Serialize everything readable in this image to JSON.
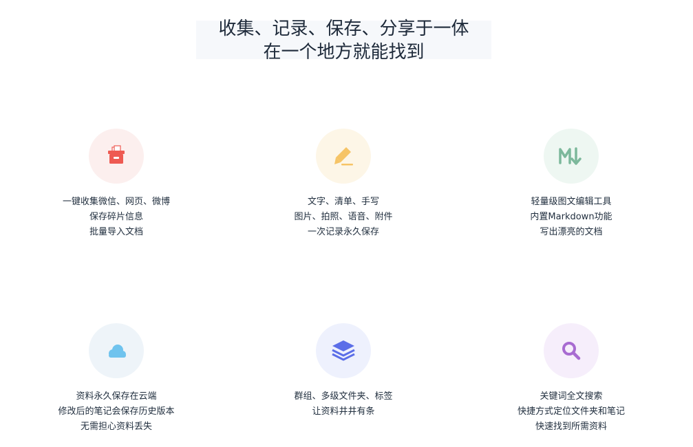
{
  "headline": {
    "line1": "收集、记录、保存、分享于一体",
    "line2": "在一个地方就能找到"
  },
  "colors": {
    "collect": "#ee5a52",
    "record": "#f6c466",
    "markdown": "#7cb89b",
    "cloud": "#6fc3ee",
    "layers": "#5b6ee8",
    "search": "#a86bd1"
  },
  "features": [
    {
      "icon": "archive-box-icon",
      "lines": [
        "一键收集微信、网页、微博",
        "保存碎片信息",
        "批量导入文档"
      ]
    },
    {
      "icon": "pencil-icon",
      "lines": [
        "文字、清单、手写",
        "图片、拍照、语音、附件",
        "一次记录永久保存"
      ]
    },
    {
      "icon": "markdown-icon",
      "lines": [
        "轻量级图文编辑工具",
        "内置Markdown功能",
        "写出漂亮的文档"
      ]
    },
    {
      "icon": "cloud-icon",
      "lines": [
        "资料永久保存在云端",
        "修改后的笔记会保存历史版本",
        "无需担心资料丢失"
      ]
    },
    {
      "icon": "layers-icon",
      "lines": [
        "群组、多级文件夹、标签",
        "让资料井井有条"
      ]
    },
    {
      "icon": "search-icon",
      "lines": [
        "关键词全文搜索",
        "快捷方式定位文件夹和笔记",
        "快速找到所需资料"
      ]
    }
  ]
}
